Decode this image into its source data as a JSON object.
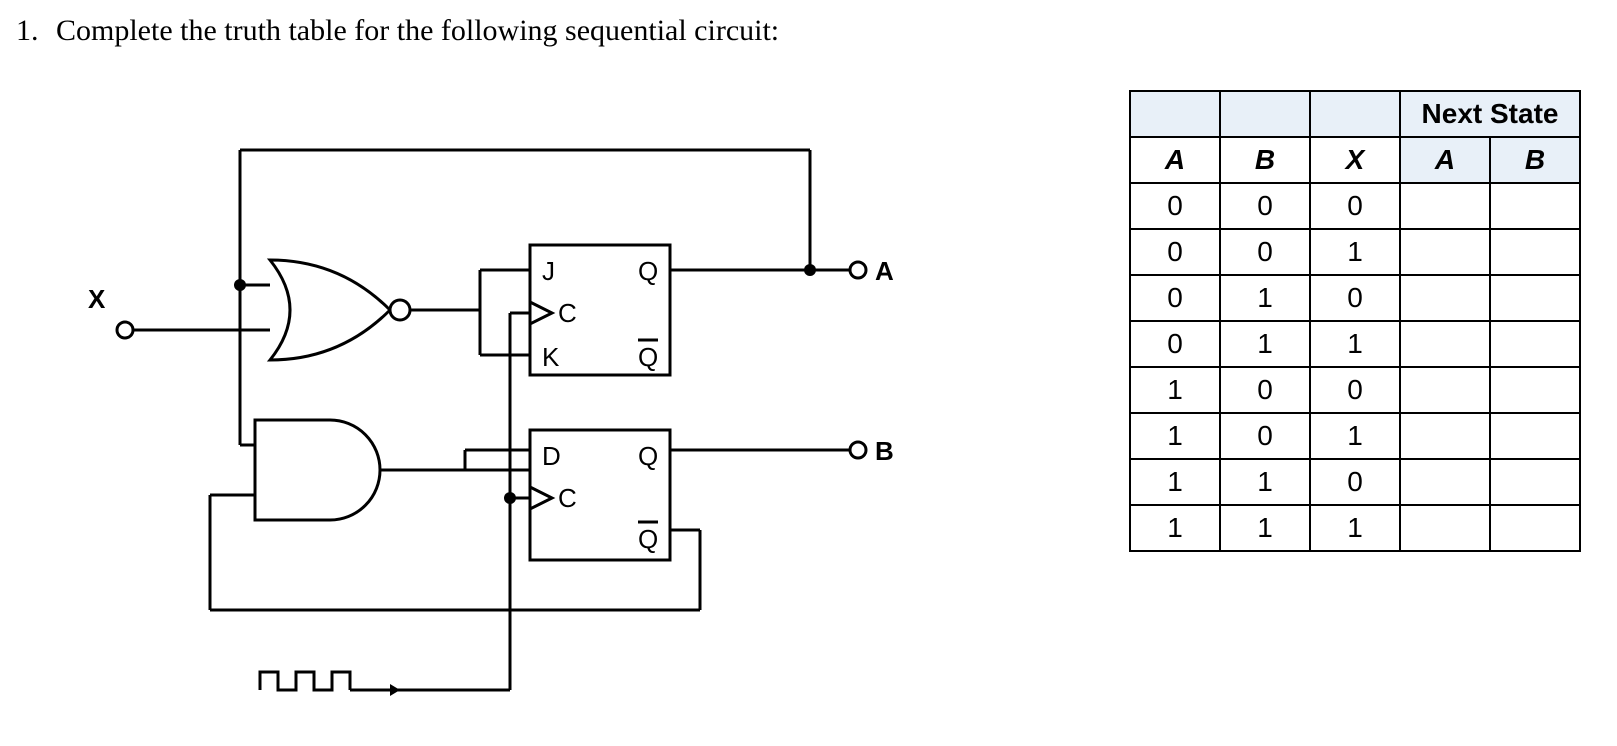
{
  "question": {
    "number": "1.",
    "text": "Complete the truth table for the following sequential circuit:"
  },
  "circuit": {
    "input_label": "X",
    "output_a_label": "A",
    "output_b_label": "B",
    "ff1": {
      "J": "J",
      "K": "K",
      "C": "C",
      "Q": "Q",
      "Qbar": "Q"
    },
    "ff2": {
      "D": "D",
      "C": "C",
      "Q": "Q",
      "Qbar": "Q"
    }
  },
  "truth_table": {
    "next_state_header": "Next State",
    "col_headers": {
      "A": "A",
      "B": "B",
      "X": "X",
      "NA": "A",
      "NB": "B"
    },
    "rows": [
      {
        "A": "0",
        "B": "0",
        "X": "0",
        "NA": "",
        "NB": ""
      },
      {
        "A": "0",
        "B": "0",
        "X": "1",
        "NA": "",
        "NB": ""
      },
      {
        "A": "0",
        "B": "1",
        "X": "0",
        "NA": "",
        "NB": ""
      },
      {
        "A": "0",
        "B": "1",
        "X": "1",
        "NA": "",
        "NB": ""
      },
      {
        "A": "1",
        "B": "0",
        "X": "0",
        "NA": "",
        "NB": ""
      },
      {
        "A": "1",
        "B": "0",
        "X": "1",
        "NA": "",
        "NB": ""
      },
      {
        "A": "1",
        "B": "1",
        "X": "0",
        "NA": "",
        "NB": ""
      },
      {
        "A": "1",
        "B": "1",
        "X": "1",
        "NA": "",
        "NB": ""
      }
    ]
  }
}
